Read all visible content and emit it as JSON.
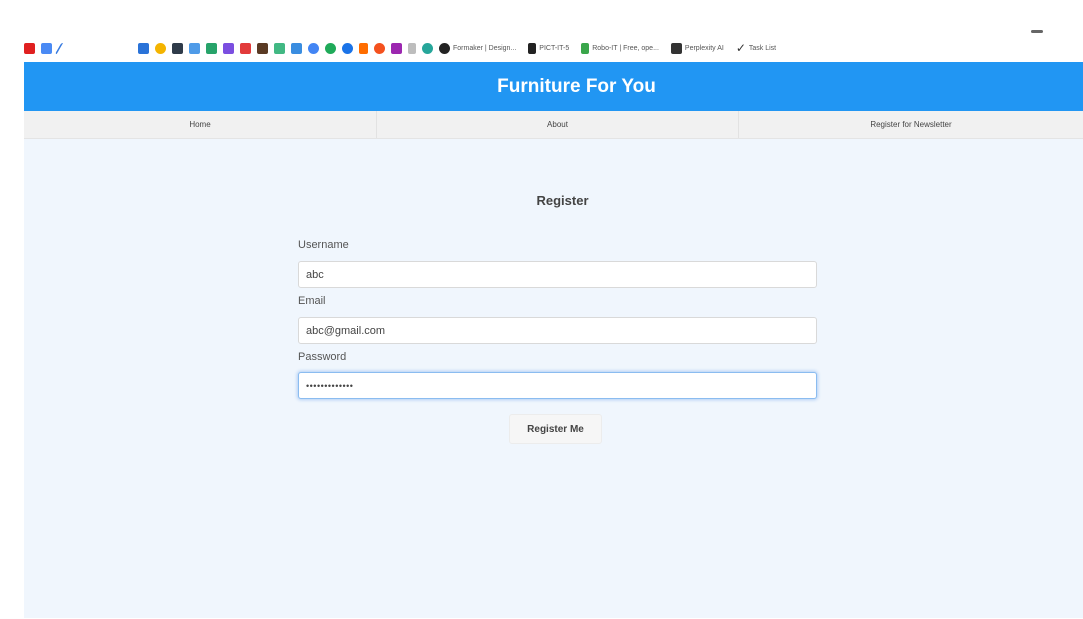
{
  "bookmarks_bar": {
    "items": [
      {
        "label": "Formaker | Design...",
        "icon": "formaker-icon",
        "color": "#222222"
      },
      {
        "label": "PICT-IT-5",
        "icon": "document-icon",
        "color": "#222222"
      },
      {
        "label": "Robo-IT | Free, ope...",
        "icon": "robot-icon",
        "color": "#3aa64b"
      },
      {
        "label": "Perplexity AI",
        "icon": "perplexity-icon",
        "color": "#333333"
      },
      {
        "label": "Task List",
        "icon": "checkmark-icon",
        "color": "#333333"
      }
    ]
  },
  "header": {
    "title": "Furniture For You",
    "color": "#2196f3"
  },
  "nav": {
    "home": "Home",
    "about": "About",
    "newsletter": "Register for Newsletter"
  },
  "form": {
    "title": "Register",
    "username_label": "Username",
    "username_value": "abc",
    "email_label": "Email",
    "email_value": "abc@gmail.com",
    "password_label": "Password",
    "password_value": "•••••••••••••",
    "submit_label": "Register Me"
  },
  "colors": {
    "page_background": "#f0f6fd",
    "focus_ring": "#8bbcf0"
  }
}
